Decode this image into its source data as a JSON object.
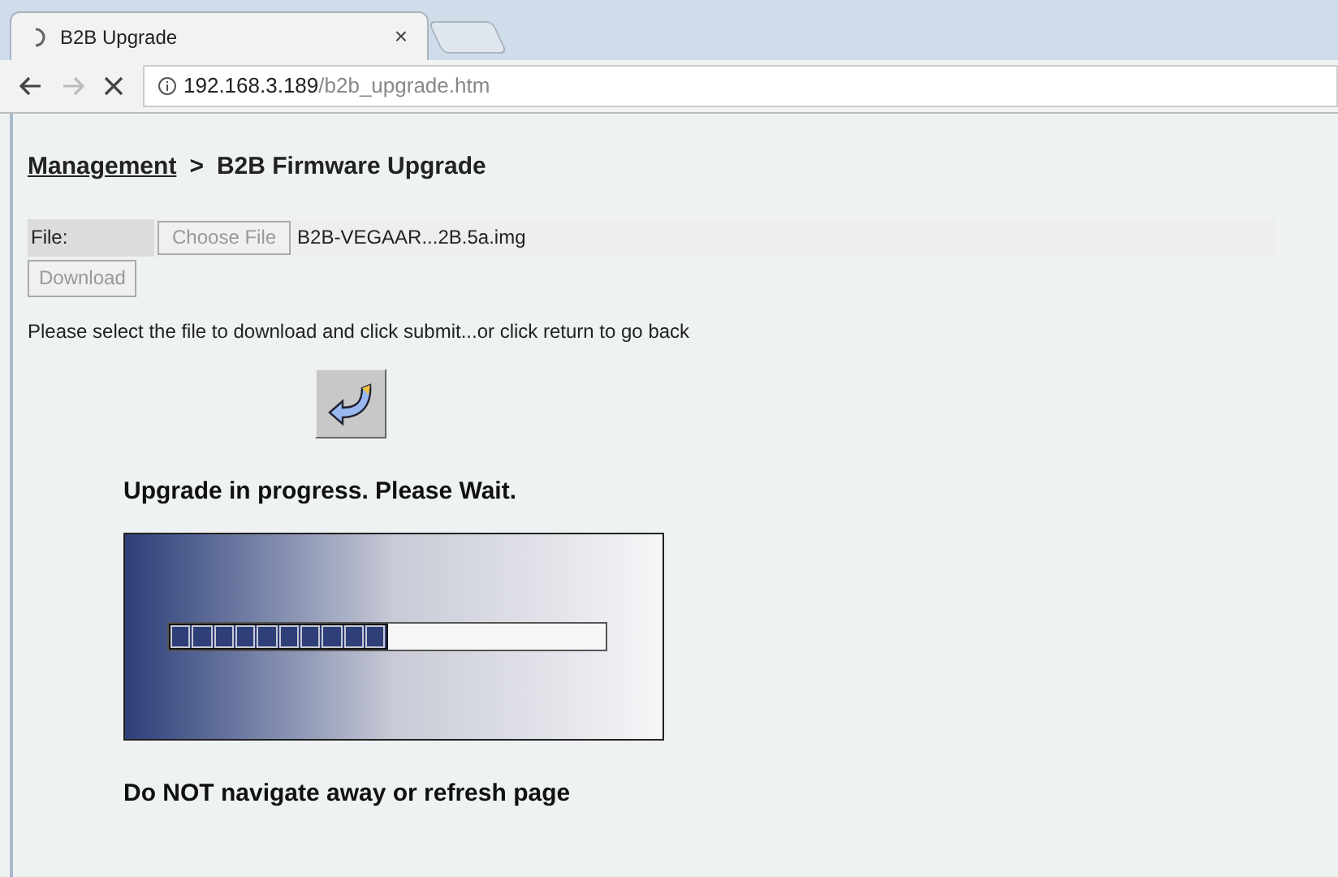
{
  "browser": {
    "tab_title": "B2B Upgrade",
    "tab_close": "×",
    "url_host": "192.168.3.189",
    "url_path": "/b2b_upgrade.htm"
  },
  "breadcrumb": {
    "link": "Management",
    "separator": ">",
    "current": "B2B Firmware Upgrade"
  },
  "file_row": {
    "label": "File:",
    "choose_button": "Choose File",
    "file_name": "B2B-VEGAAR...2B.5a.img"
  },
  "download_button": {
    "label": "Download",
    "disabled": true
  },
  "instructions": "Please select the file to download and click submit...or click return to go back",
  "status_heading": "Upgrade in progress. Please Wait.",
  "progress": {
    "level": 0.5
  },
  "warning": "Do NOT navigate away or refresh page"
}
